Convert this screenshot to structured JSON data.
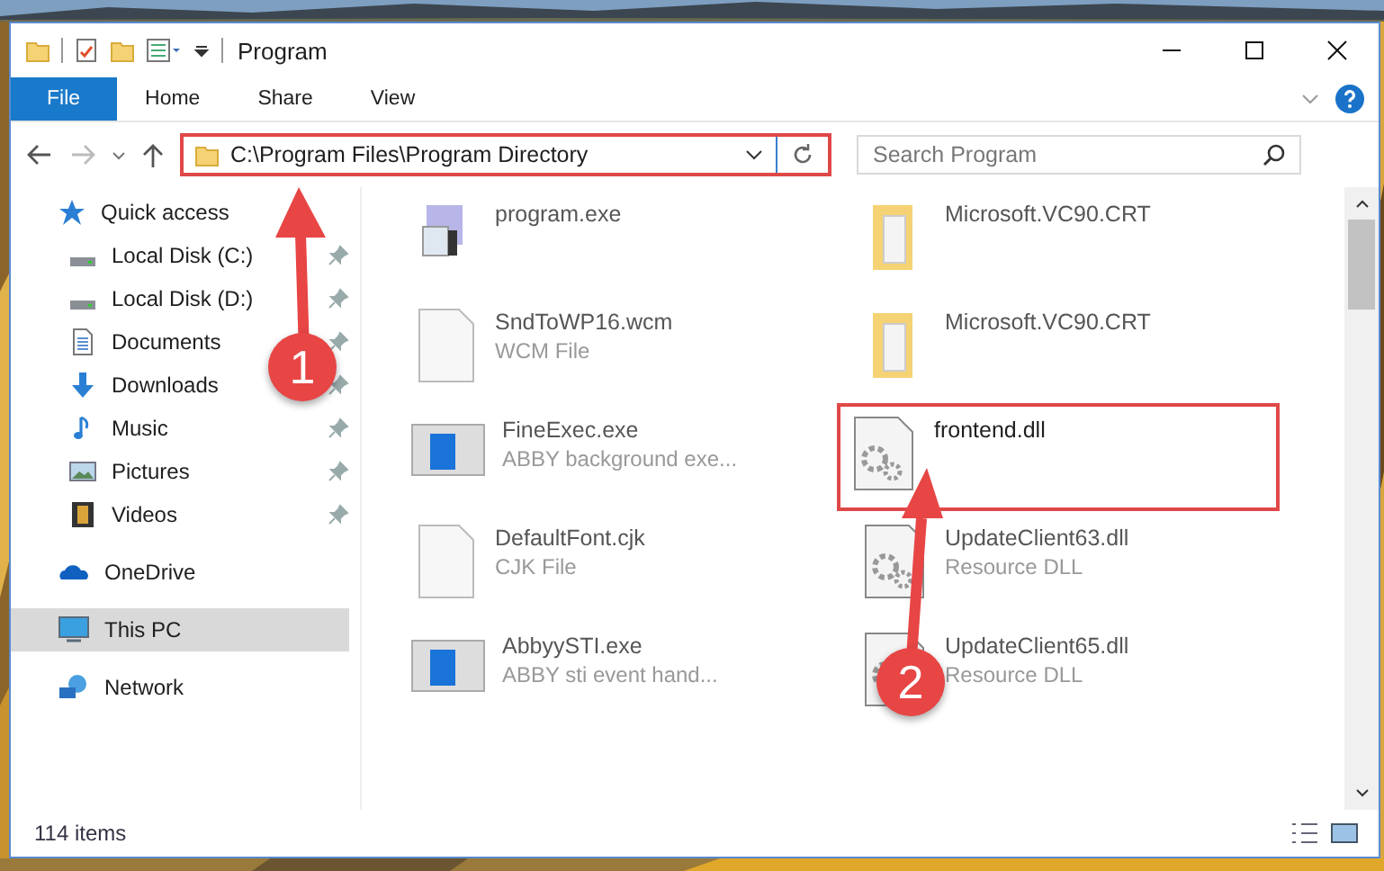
{
  "window": {
    "title": "Program"
  },
  "ribbon_tabs": [
    {
      "label": "File",
      "selected": true
    },
    {
      "label": "Home",
      "selected": false
    },
    {
      "label": "Share",
      "selected": false
    },
    {
      "label": "View",
      "selected": false
    }
  ],
  "address": {
    "path": "C:\\Program Files\\Program Directory",
    "highlighted": true
  },
  "search": {
    "placeholder": "Search Program"
  },
  "sidebar": {
    "items": [
      {
        "label": "Quick access",
        "kind": "star",
        "pinned": false,
        "selected": false
      },
      {
        "label": "Local Disk (C:)",
        "kind": "drive",
        "pinned": true,
        "selected": false
      },
      {
        "label": "Local Disk (D:)",
        "kind": "drive",
        "pinned": true,
        "selected": false
      },
      {
        "label": "Documents",
        "kind": "document",
        "pinned": true,
        "selected": false
      },
      {
        "label": "Downloads",
        "kind": "download",
        "pinned": true,
        "selected": false
      },
      {
        "label": "Music",
        "kind": "music",
        "pinned": true,
        "selected": false
      },
      {
        "label": "Pictures",
        "kind": "pictures",
        "pinned": true,
        "selected": false
      },
      {
        "label": "Videos",
        "kind": "videos",
        "pinned": true,
        "selected": false
      },
      {
        "label": "OneDrive",
        "kind": "cloud",
        "pinned": false,
        "selected": false
      },
      {
        "label": "This PC",
        "kind": "computer",
        "pinned": false,
        "selected": true
      },
      {
        "label": "Network",
        "kind": "network",
        "pinned": false,
        "selected": false
      }
    ]
  },
  "files": [
    {
      "name": "program.exe",
      "kind": "setup",
      "highlighted": false,
      "blurred": true
    },
    {
      "name": "Microsoft.VC90.CRT",
      "kind": "folder",
      "highlighted": false,
      "blurred": true
    },
    {
      "name": "SndToWP16.wcm",
      "type": "WCM File",
      "kind": "blank",
      "highlighted": false,
      "blurred": true
    },
    {
      "name": "Microsoft.VC90.CRT",
      "kind": "folder",
      "highlighted": false,
      "blurred": true
    },
    {
      "name": "FineExec.exe",
      "type": "ABBY background exe...",
      "kind": "window",
      "highlighted": false,
      "blurred": true
    },
    {
      "name": "frontend.dll",
      "kind": "dll",
      "highlighted": true,
      "blurred": false
    },
    {
      "name": "DefaultFont.cjk",
      "type": "CJK File",
      "kind": "blank",
      "highlighted": false,
      "blurred": true
    },
    {
      "name": "UpdateClient63.dll",
      "type": "Resource DLL",
      "kind": "dll",
      "highlighted": false,
      "blurred": true
    },
    {
      "name": "AbbyySTI.exe",
      "type": "ABBY sti event hand...",
      "kind": "window",
      "highlighted": false,
      "blurred": true
    },
    {
      "name": "UpdateClient65.dll",
      "type": "Resource DLL",
      "kind": "dll",
      "highlighted": false,
      "blurred": true
    }
  ],
  "status_bar": {
    "count": "114 items"
  },
  "annotations": [
    {
      "number": "1"
    },
    {
      "number": "2"
    }
  ]
}
